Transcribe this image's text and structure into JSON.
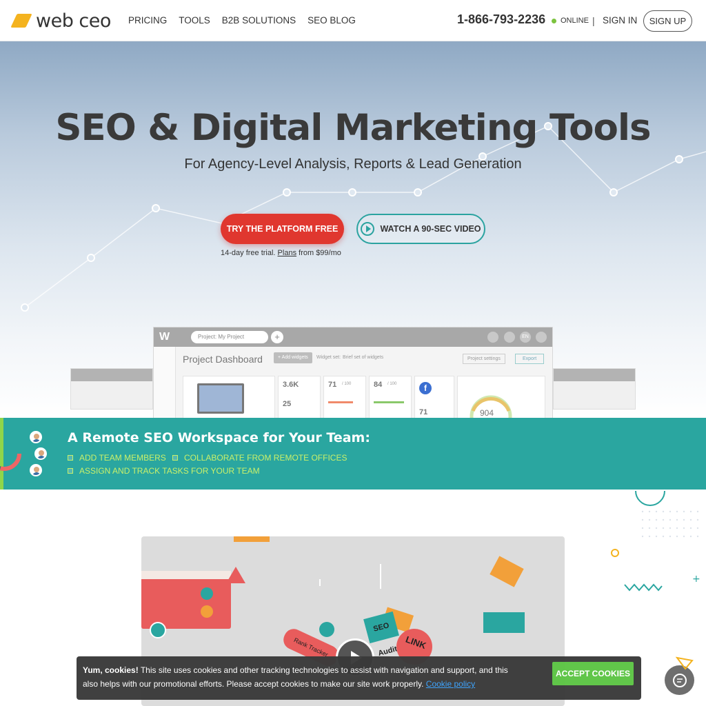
{
  "header": {
    "logo_text": "web ceo",
    "nav": [
      "PRICING",
      "TOOLS",
      "B2B SOLUTIONS",
      "SEO BLOG"
    ],
    "phone": "1-866-793-2236",
    "online_label": "ONLINE",
    "separator": "|",
    "sign_in": "SIGN IN",
    "sign_up": "SIGN UP"
  },
  "hero": {
    "title": "SEO & Digital Marketing Tools",
    "subtitle": "For Agency-Level Analysis, Reports & Lead Generation",
    "primary_button": "TRY THE PLATFORM FREE",
    "video_button": "WATCH A 90-SEC VIDEO",
    "trial_prefix": "14-day free trial. ",
    "trial_link": "Plans",
    "trial_suffix": " from $99/mo"
  },
  "dashboard": {
    "logo": "W",
    "project_select": "Project: My Project",
    "title": "Project Dashboard",
    "add_widgets": "+ Add widgets",
    "widget_set_label": "Widget set:",
    "widget_set_value": "Brief set of widgets",
    "project_settings": "Project settings",
    "export": "Export",
    "lang": "EN",
    "metrics": [
      "3.6K",
      "25",
      "71",
      "/ 100",
      "84",
      "/ 100",
      "71",
      "904"
    ]
  },
  "band": {
    "title": "A Remote SEO Workspace for Your Team:",
    "items": [
      "ADD TEAM MEMBERS",
      "COLLABORATE FROM REMOTE OFFICES",
      "ASSIGN AND TRACK TASKS FOR YOUR TEAM"
    ]
  },
  "video_tags": [
    "SEO Audit",
    "LINK",
    "Rank Tracker"
  ],
  "cookie": {
    "lead": "Yum, cookies!",
    "text": " This site uses cookies and other tracking technologies to assist with navigation and support, and this also helps with our promotional efforts. Please accept cookies to make our site work properly. ",
    "link": "Cookie policy",
    "button": "ACCEPT COOKIES"
  },
  "colors": {
    "accent_red": "#e0372f",
    "teal": "#2aa6a0",
    "lime": "#c9f06a",
    "green_button": "#5cc545",
    "logo_yellow": "#f4b31f"
  }
}
